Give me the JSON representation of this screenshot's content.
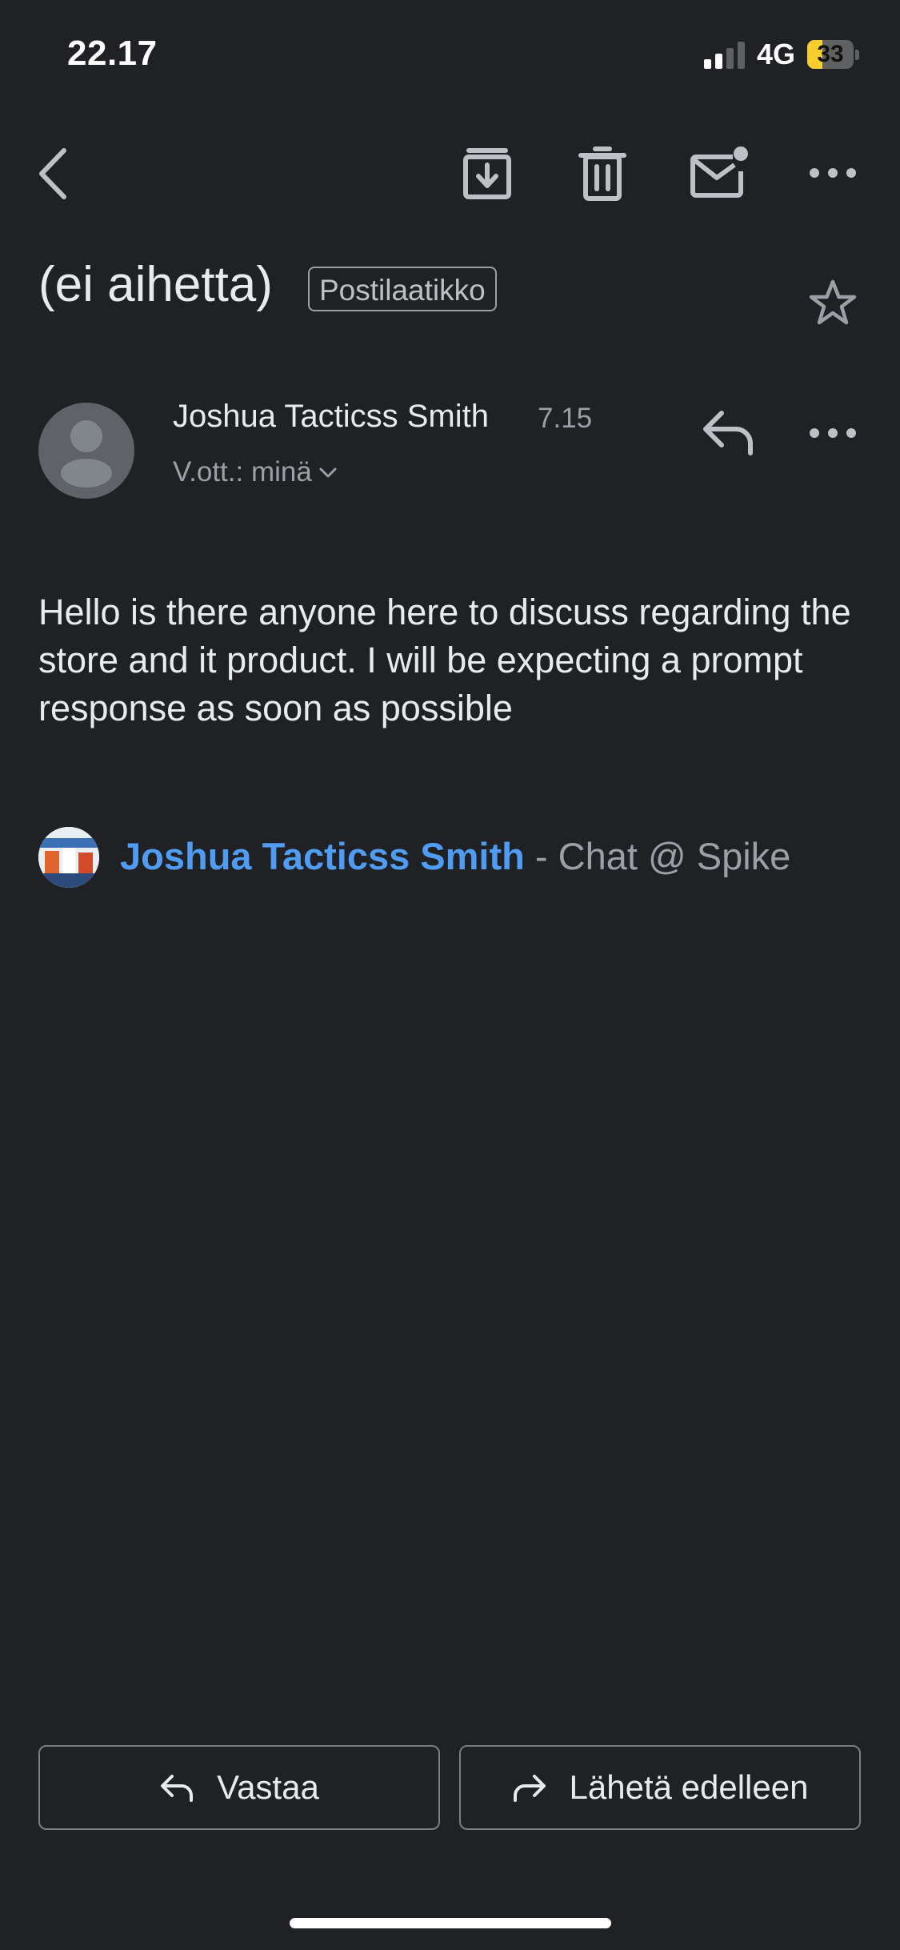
{
  "status_bar": {
    "time": "22.17",
    "network": "4G",
    "battery_percent": "33",
    "battery_level": 0.33,
    "signal_bars": 2,
    "signal_bars_total": 4
  },
  "toolbar": {
    "back_icon": "chevron-left-icon",
    "archive_icon": "archive-icon",
    "delete_icon": "trash-icon",
    "unread_icon": "mark-unread-icon",
    "more_icon": "more-horizontal-icon"
  },
  "email": {
    "subject": "(ei aihetta)",
    "label": "Postilaatikko",
    "sender_name": "Joshua Tacticss Smith",
    "time": "7.15",
    "recipient": "V.ott.: minä",
    "body": "Hello is there anyone here to discuss regarding the store and it product. I will be expecting a prompt response as soon as possible",
    "signature_name": "Joshua Tacticss Smith",
    "signature_rest": " - Chat @ Spike"
  },
  "actions": {
    "reply_label": "Vastaa",
    "forward_label": "Lähetä edelleen"
  },
  "colors": {
    "background": "#202124",
    "link": "#4f9cf2",
    "battery_fill": "#f7ce2c"
  }
}
